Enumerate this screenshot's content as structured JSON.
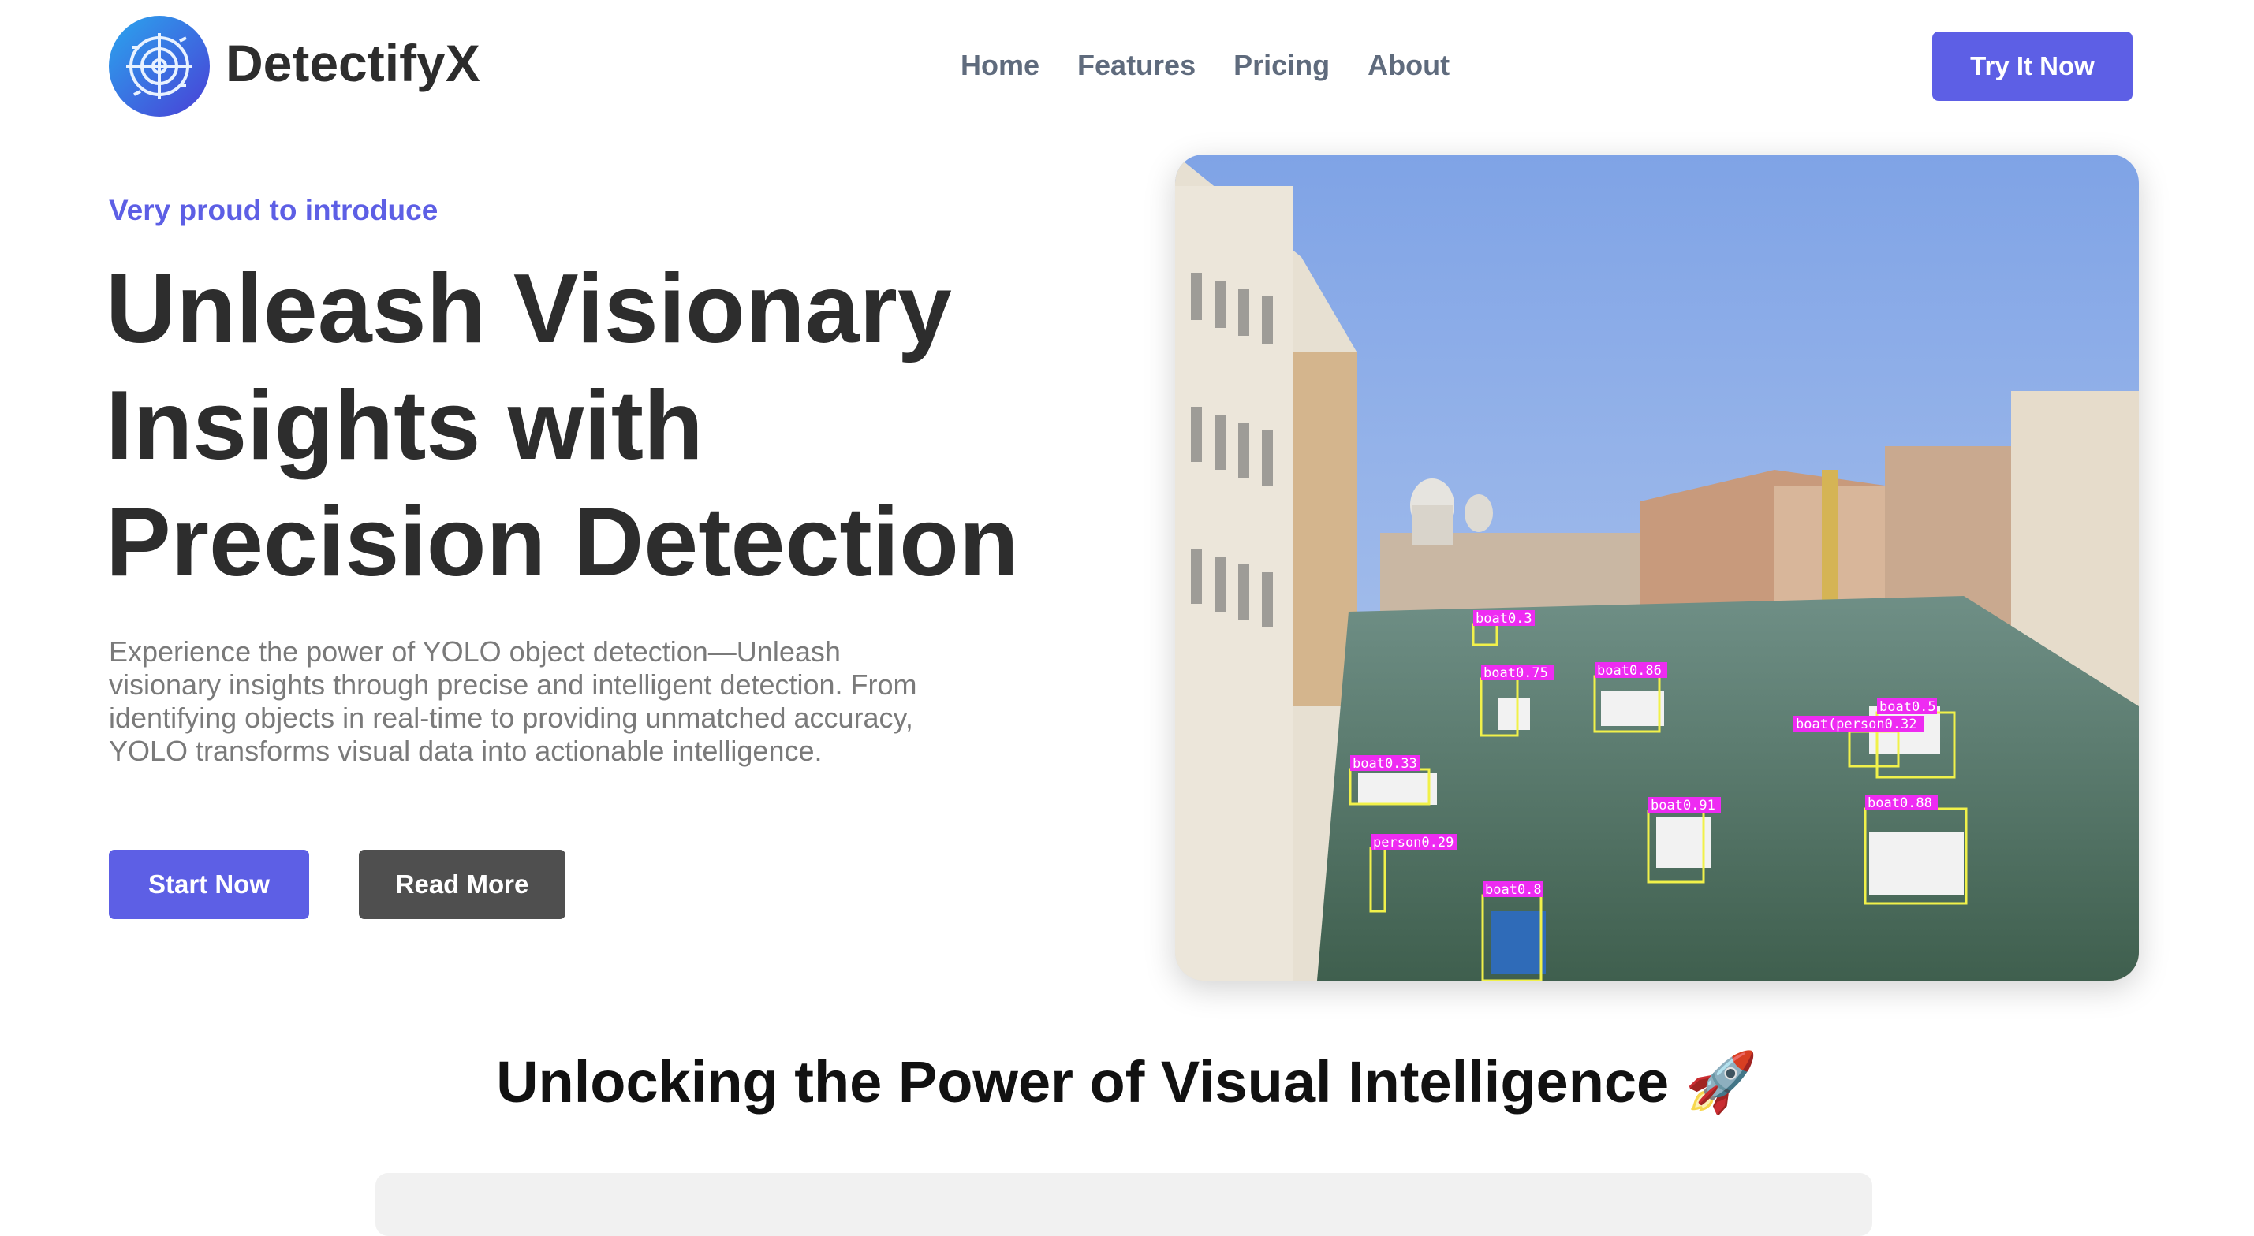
{
  "brand": {
    "name": "DetectifyX",
    "logo_icon": "radar-target-icon"
  },
  "nav": {
    "items": [
      "Home",
      "Features",
      "Pricing",
      "About"
    ]
  },
  "header": {
    "cta_label": "Try It Now"
  },
  "hero": {
    "eyebrow": "Very proud to introduce",
    "headline": "Unleash Visionary Insights with Precision Detection",
    "description": "Experience the power of YOLO object detection—Unleash visionary insights through precise and intelligent detection. From identifying objects in real-time to providing unmatched accuracy, YOLO transforms visual data into actionable intelligence.",
    "primary_button": "Start Now",
    "secondary_button": "Read More",
    "image": {
      "detections": [
        {
          "label": "boat0.3"
        },
        {
          "label": "boat0.75"
        },
        {
          "label": "boat0.86"
        },
        {
          "label": "boat0.33"
        },
        {
          "label": "boat(person0.32"
        },
        {
          "label": "boat0.5"
        },
        {
          "label": "boat0.91"
        },
        {
          "label": "boat0.88"
        },
        {
          "label": "person0.29"
        },
        {
          "label": "boat0.8"
        }
      ]
    }
  },
  "section": {
    "title": "Unlocking the Power of Visual Intelligence 🚀"
  },
  "colors": {
    "accent": "#5d5fe5",
    "dark_button": "#4f4f4f",
    "heading": "#2d2d2d",
    "box": "#f1f14a",
    "tag": "#ee2bf2"
  }
}
